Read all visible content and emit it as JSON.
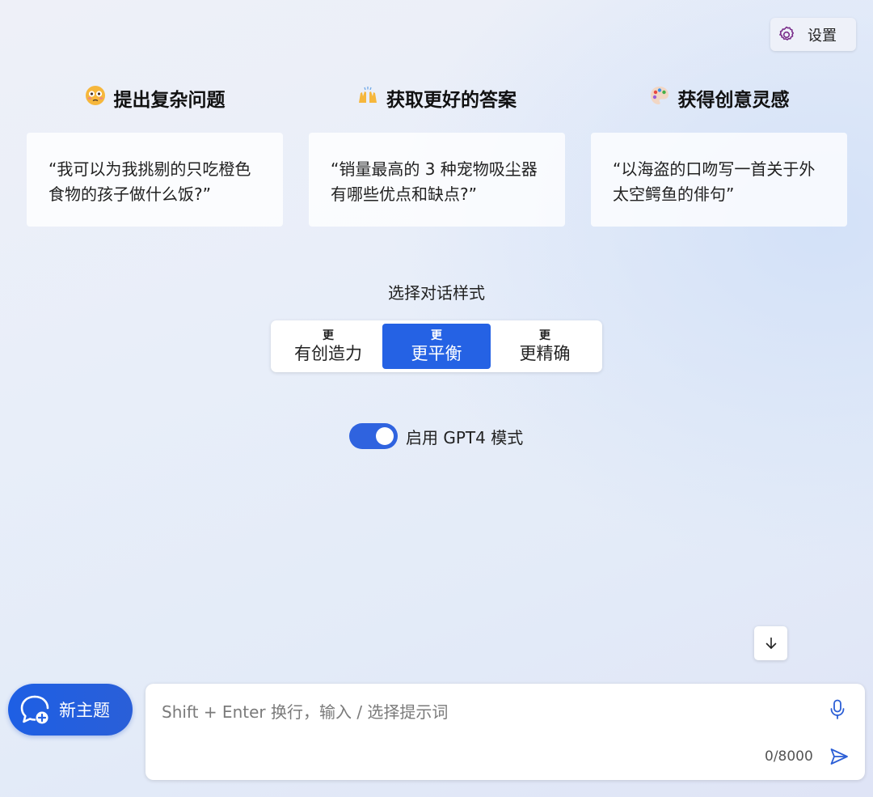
{
  "header": {
    "settings_label": "设置"
  },
  "features": [
    {
      "emoji": "flushed-face-icon",
      "title": "提出复杂问题",
      "example": "“我可以为我挑剔的只吃橙色食物的孩子做什么饭?”"
    },
    {
      "emoji": "raising-hands-icon",
      "title": "获取更好的答案",
      "example": "“销量最高的 3 种宠物吸尘器有哪些优点和缺点?”"
    },
    {
      "emoji": "artist-palette-icon",
      "title": "获得创意灵感",
      "example": "“以海盗的口吻写一首关于外太空鳄鱼的俳句”"
    }
  ],
  "conversation_style": {
    "label": "选择对话样式",
    "options": [
      {
        "prefix": "更",
        "label": "有创造力",
        "selected": false
      },
      {
        "prefix": "更",
        "label": "更平衡",
        "selected": true
      },
      {
        "prefix": "更",
        "label": "更精确",
        "selected": false
      }
    ]
  },
  "gpt4_toggle": {
    "label": "启用 GPT4 模式",
    "enabled": true
  },
  "new_topic": {
    "label": "新主题"
  },
  "composer": {
    "placeholder": "Shift + Enter 换行，输入 / 选择提示词",
    "value": "",
    "counter": "0/8000"
  },
  "colors": {
    "accent": "#2562e4",
    "toggle": "#2f63df",
    "card_bg": "#ffffff"
  }
}
